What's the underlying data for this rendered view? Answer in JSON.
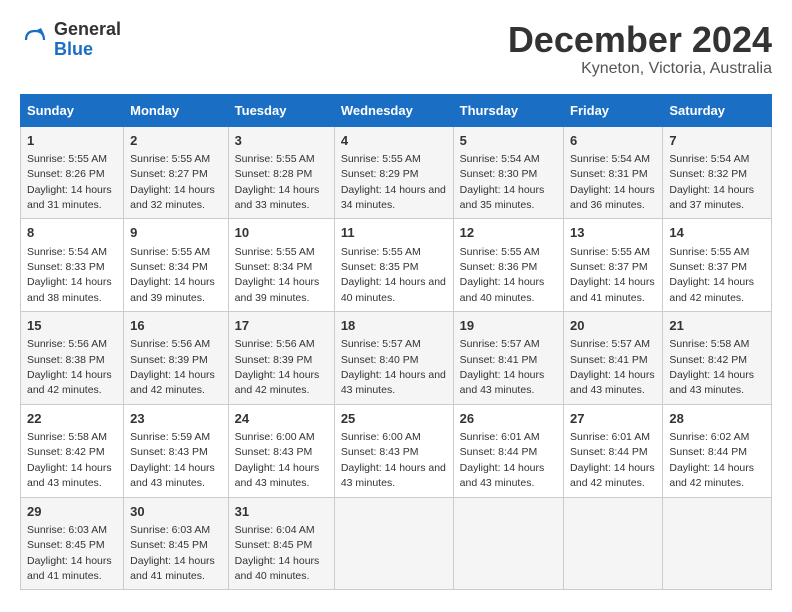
{
  "logo": {
    "line1": "General",
    "line2": "Blue"
  },
  "title": "December 2024",
  "subtitle": "Kyneton, Victoria, Australia",
  "days_header": [
    "Sunday",
    "Monday",
    "Tuesday",
    "Wednesday",
    "Thursday",
    "Friday",
    "Saturday"
  ],
  "weeks": [
    [
      {
        "day": "1",
        "sunrise": "5:55 AM",
        "sunset": "8:26 PM",
        "daylight": "14 hours and 31 minutes."
      },
      {
        "day": "2",
        "sunrise": "5:55 AM",
        "sunset": "8:27 PM",
        "daylight": "14 hours and 32 minutes."
      },
      {
        "day": "3",
        "sunrise": "5:55 AM",
        "sunset": "8:28 PM",
        "daylight": "14 hours and 33 minutes."
      },
      {
        "day": "4",
        "sunrise": "5:55 AM",
        "sunset": "8:29 PM",
        "daylight": "14 hours and 34 minutes."
      },
      {
        "day": "5",
        "sunrise": "5:54 AM",
        "sunset": "8:30 PM",
        "daylight": "14 hours and 35 minutes."
      },
      {
        "day": "6",
        "sunrise": "5:54 AM",
        "sunset": "8:31 PM",
        "daylight": "14 hours and 36 minutes."
      },
      {
        "day": "7",
        "sunrise": "5:54 AM",
        "sunset": "8:32 PM",
        "daylight": "14 hours and 37 minutes."
      }
    ],
    [
      {
        "day": "8",
        "sunrise": "5:54 AM",
        "sunset": "8:33 PM",
        "daylight": "14 hours and 38 minutes."
      },
      {
        "day": "9",
        "sunrise": "5:55 AM",
        "sunset": "8:34 PM",
        "daylight": "14 hours and 39 minutes."
      },
      {
        "day": "10",
        "sunrise": "5:55 AM",
        "sunset": "8:34 PM",
        "daylight": "14 hours and 39 minutes."
      },
      {
        "day": "11",
        "sunrise": "5:55 AM",
        "sunset": "8:35 PM",
        "daylight": "14 hours and 40 minutes."
      },
      {
        "day": "12",
        "sunrise": "5:55 AM",
        "sunset": "8:36 PM",
        "daylight": "14 hours and 40 minutes."
      },
      {
        "day": "13",
        "sunrise": "5:55 AM",
        "sunset": "8:37 PM",
        "daylight": "14 hours and 41 minutes."
      },
      {
        "day": "14",
        "sunrise": "5:55 AM",
        "sunset": "8:37 PM",
        "daylight": "14 hours and 42 minutes."
      }
    ],
    [
      {
        "day": "15",
        "sunrise": "5:56 AM",
        "sunset": "8:38 PM",
        "daylight": "14 hours and 42 minutes."
      },
      {
        "day": "16",
        "sunrise": "5:56 AM",
        "sunset": "8:39 PM",
        "daylight": "14 hours and 42 minutes."
      },
      {
        "day": "17",
        "sunrise": "5:56 AM",
        "sunset": "8:39 PM",
        "daylight": "14 hours and 42 minutes."
      },
      {
        "day": "18",
        "sunrise": "5:57 AM",
        "sunset": "8:40 PM",
        "daylight": "14 hours and 43 minutes."
      },
      {
        "day": "19",
        "sunrise": "5:57 AM",
        "sunset": "8:41 PM",
        "daylight": "14 hours and 43 minutes."
      },
      {
        "day": "20",
        "sunrise": "5:57 AM",
        "sunset": "8:41 PM",
        "daylight": "14 hours and 43 minutes."
      },
      {
        "day": "21",
        "sunrise": "5:58 AM",
        "sunset": "8:42 PM",
        "daylight": "14 hours and 43 minutes."
      }
    ],
    [
      {
        "day": "22",
        "sunrise": "5:58 AM",
        "sunset": "8:42 PM",
        "daylight": "14 hours and 43 minutes."
      },
      {
        "day": "23",
        "sunrise": "5:59 AM",
        "sunset": "8:43 PM",
        "daylight": "14 hours and 43 minutes."
      },
      {
        "day": "24",
        "sunrise": "6:00 AM",
        "sunset": "8:43 PM",
        "daylight": "14 hours and 43 minutes."
      },
      {
        "day": "25",
        "sunrise": "6:00 AM",
        "sunset": "8:43 PM",
        "daylight": "14 hours and 43 minutes."
      },
      {
        "day": "26",
        "sunrise": "6:01 AM",
        "sunset": "8:44 PM",
        "daylight": "14 hours and 43 minutes."
      },
      {
        "day": "27",
        "sunrise": "6:01 AM",
        "sunset": "8:44 PM",
        "daylight": "14 hours and 42 minutes."
      },
      {
        "day": "28",
        "sunrise": "6:02 AM",
        "sunset": "8:44 PM",
        "daylight": "14 hours and 42 minutes."
      }
    ],
    [
      {
        "day": "29",
        "sunrise": "6:03 AM",
        "sunset": "8:45 PM",
        "daylight": "14 hours and 41 minutes."
      },
      {
        "day": "30",
        "sunrise": "6:03 AM",
        "sunset": "8:45 PM",
        "daylight": "14 hours and 41 minutes."
      },
      {
        "day": "31",
        "sunrise": "6:04 AM",
        "sunset": "8:45 PM",
        "daylight": "14 hours and 40 minutes."
      },
      null,
      null,
      null,
      null
    ]
  ]
}
